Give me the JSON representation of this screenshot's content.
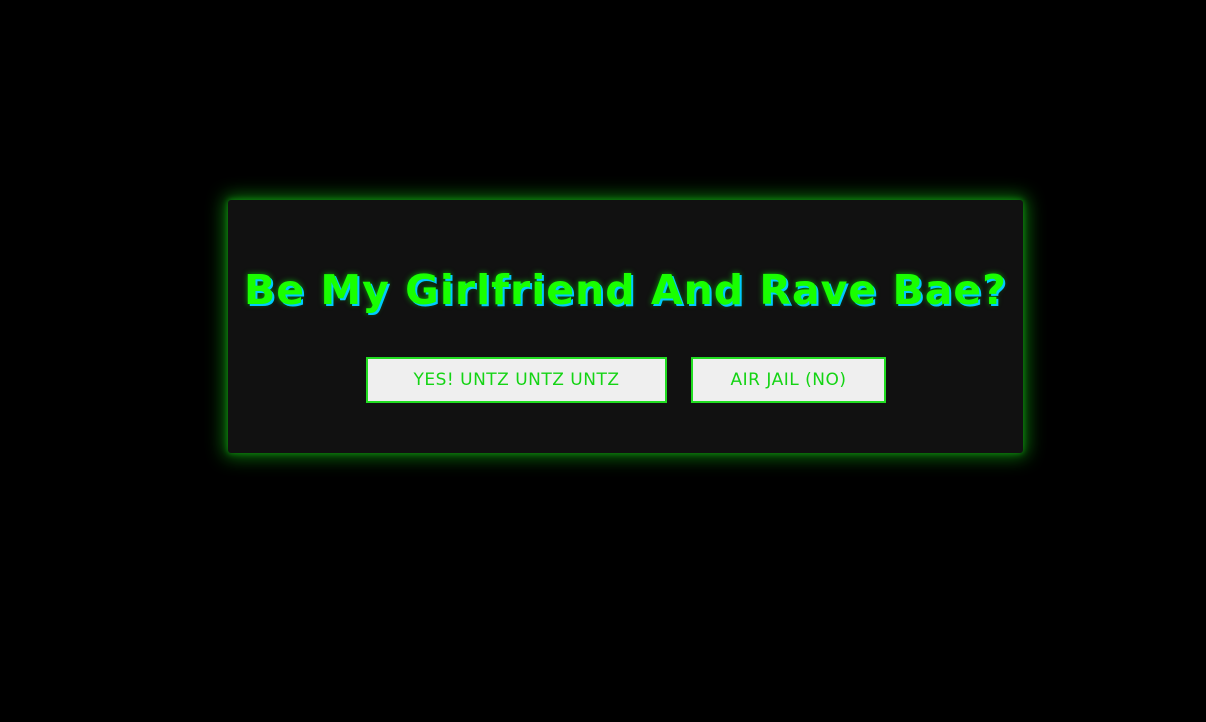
{
  "dialog": {
    "title": "Be My Girlfriend And Rave Bae?",
    "yes_label": "YES! UNTZ UNTZ UNTZ",
    "no_label": "AIR JAIL (NO)"
  },
  "colors": {
    "background": "#000000",
    "card": "#111111",
    "accent_green": "#19ff00",
    "title_shadow": "#00c8ff",
    "button_bg": "#efefef",
    "button_border": "#22dd22"
  }
}
